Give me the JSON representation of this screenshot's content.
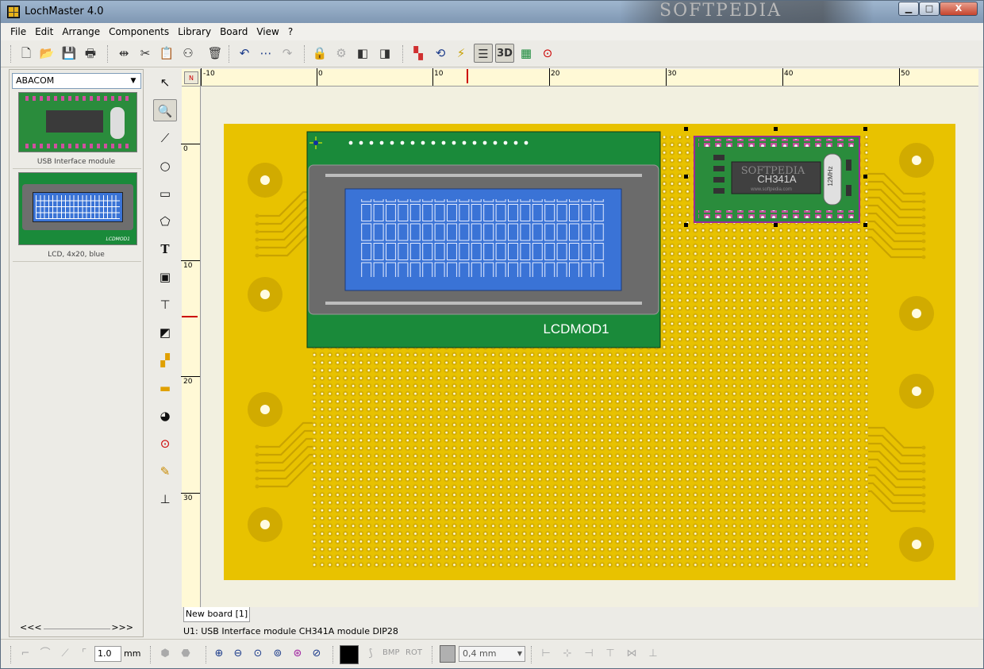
{
  "window": {
    "title": "LochMaster 4.0",
    "watermark": "SOFTPEDIA",
    "min_label": "▁",
    "max_label": "□",
    "close_label": "X"
  },
  "menu": [
    "File",
    "Edit",
    "Arrange",
    "Components",
    "Library",
    "Board",
    "View",
    "?"
  ],
  "toolbar": {
    "file": [
      "new-icon",
      "open-icon",
      "save-icon",
      "print-icon"
    ],
    "edit": [
      "mirror-icon",
      "cut-icon",
      "paste-icon",
      "duplicate-icon",
      "delete-icon"
    ],
    "history": [
      "undo-icon",
      "more-icon",
      "redo-icon"
    ],
    "arrange": [
      "lock-icon",
      "group-icon",
      "to-front-icon",
      "to-back-icon"
    ],
    "view": [
      "colors-icon",
      "rotate-icon",
      "flip-icon",
      "layers-icon",
      "3d-icon",
      "board-icon",
      "target-icon"
    ],
    "3d_label": "3D"
  },
  "library": {
    "selected": "ABACOM",
    "items": [
      {
        "caption": "USB Interface module"
      },
      {
        "caption": "LCD, 4x20, blue"
      }
    ],
    "thumb_labels": {
      "lcd": "LCDMOD1"
    },
    "scroll_left": "<<<",
    "scroll_right": ">>>"
  },
  "vertical_tools": [
    "pointer-icon",
    "zoom-icon",
    "line-icon",
    "ellipse-icon",
    "rectangle-icon",
    "polygon-icon",
    "text-icon",
    "component-icon",
    "wire-icon",
    "pad-icon",
    "bridge-icon",
    "cut-trace-icon",
    "drill-icon",
    "solder-icon",
    "measure-icon",
    "dimension-icon"
  ],
  "rulers": {
    "top": [
      "-10",
      "0",
      "10",
      "20",
      "30",
      "40",
      "50"
    ],
    "left": [
      "0",
      "10",
      "20",
      "30"
    ],
    "corner": "N"
  },
  "board": {
    "lcd_label": "LCDMOD1",
    "module_chip": "CH341A",
    "module_crystal": "12MHz",
    "module_watermark": "SOFTPEDIA",
    "module_url": "www.softpedia.com"
  },
  "tabs": [
    "New board [1]"
  ],
  "status": "U1: USB Interface module CH341A module DIP28",
  "bottom": {
    "line_width": "1.0",
    "line_unit": "mm",
    "bmp_label": "BMP",
    "rot_label": "ROT",
    "trace_width": "0,4 mm"
  },
  "colors": {
    "board": "#e8c200",
    "lcd_pcb": "#1a8a3a",
    "lcd_screen": "#3a73d6",
    "module_pcb": "#2a8c3c",
    "accent": "#c00000"
  }
}
